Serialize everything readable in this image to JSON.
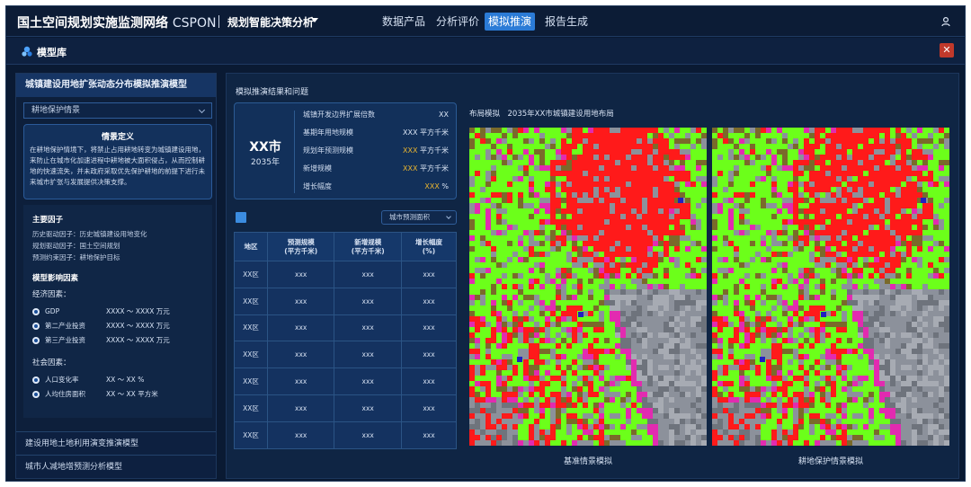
{
  "header": {
    "brand": "国土空间规划实施监测网络",
    "brand_latin": "CSPON",
    "subsystem": "规划智能决策分析",
    "nav": [
      "数据产品",
      "分析评价",
      "模拟推演",
      "报告生成"
    ],
    "active_nav": "模拟推演"
  },
  "model_bar": {
    "title": "模型库"
  },
  "left_panel": {
    "title": "城镇建设用地扩张动态分布模拟推演模型",
    "scenario_select": "耕地保护情景",
    "definition": {
      "title": "情景定义",
      "text": "在耕地保护情境下，将禁止占用耕地转变为城镇建设用地，来防止在城市化加速进程中耕地被大面积侵占，从而控制耕地的快速流失，并未政府采取优先保护耕地的前提下进行未来城市扩张与发展提供决策支撑。"
    },
    "main_factors": {
      "title": "主要因子",
      "lines": [
        "历史驱动因子：历史城镇建设用地变化",
        "规划驱动因子：国土空间规划",
        "预测约束因子：耕地保护目标"
      ]
    },
    "influence": {
      "title": "模型影响因素",
      "economic_title": "经济因素：",
      "economic": [
        {
          "label": "GDP",
          "range": "XXXX ～ XXXX  万元"
        },
        {
          "label": "第二产业投资",
          "range": "XXXX ～ XXXX  万元"
        },
        {
          "label": "第三产业投资",
          "range": "XXXX ～ XXXX  万元"
        }
      ],
      "social_title": "社会因素：",
      "social": [
        {
          "label": "人口变化率",
          "range": "XX ～ XX %"
        },
        {
          "label": "人均住房面积",
          "range": "XX ～ XX 平方米"
        }
      ]
    },
    "other_models": [
      "建设用地土地利用演变推演模型",
      "城市人减地增预测分析模型"
    ]
  },
  "right_panel": {
    "title": "模拟推演结果和问题",
    "city": {
      "name": "XX市",
      "year": "2035年"
    },
    "stats": [
      {
        "label": "城镇开发边界扩展倍数",
        "value": "XX",
        "unit": "",
        "highlight": false
      },
      {
        "label": "基期年用地规模",
        "value": "XXX",
        "unit": "平方千米",
        "highlight": false
      },
      {
        "label": "规划年预测规模",
        "value": "XXX",
        "unit": "平方千米",
        "highlight": true
      },
      {
        "label": "新增规模",
        "value": "XXX",
        "unit": "平方千米",
        "highlight": true
      },
      {
        "label": "增长幅度",
        "value": "XXX",
        "unit": "%",
        "highlight": true
      }
    ],
    "table_select": "城市预测面积",
    "table": {
      "headers": [
        "地区",
        "预测规模\n(平方千米)",
        "新增规模\n(平方千米)",
        "增长幅度\n(%)"
      ],
      "rows": [
        [
          "XX区",
          "xxx",
          "xxx",
          "xxx"
        ],
        [
          "XX区",
          "xxx",
          "xxx",
          "xxx"
        ],
        [
          "XX区",
          "xxx",
          "xxx",
          "xxx"
        ],
        [
          "XX区",
          "xxx",
          "xxx",
          "xxx"
        ],
        [
          "XX区",
          "xxx",
          "xxx",
          "xxx"
        ],
        [
          "XX区",
          "xxx",
          "xxx",
          "xxx"
        ],
        [
          "XX区",
          "xxx",
          "xxx",
          "xxx"
        ]
      ]
    },
    "maps": {
      "title": "布局模拟　2035年XX市城镇建设用地布局",
      "left_label": "基准情景模拟",
      "right_label": "耕地保护情景模拟"
    }
  },
  "colors": {
    "accent": "#2b7bd6",
    "highlight": "#e8b430",
    "map_urban": "#ff1a1a",
    "map_cropland": "#6cff1a",
    "map_expansion": "#e22bb0",
    "map_other": "#7a6a2a",
    "map_water": "#2020c0"
  }
}
